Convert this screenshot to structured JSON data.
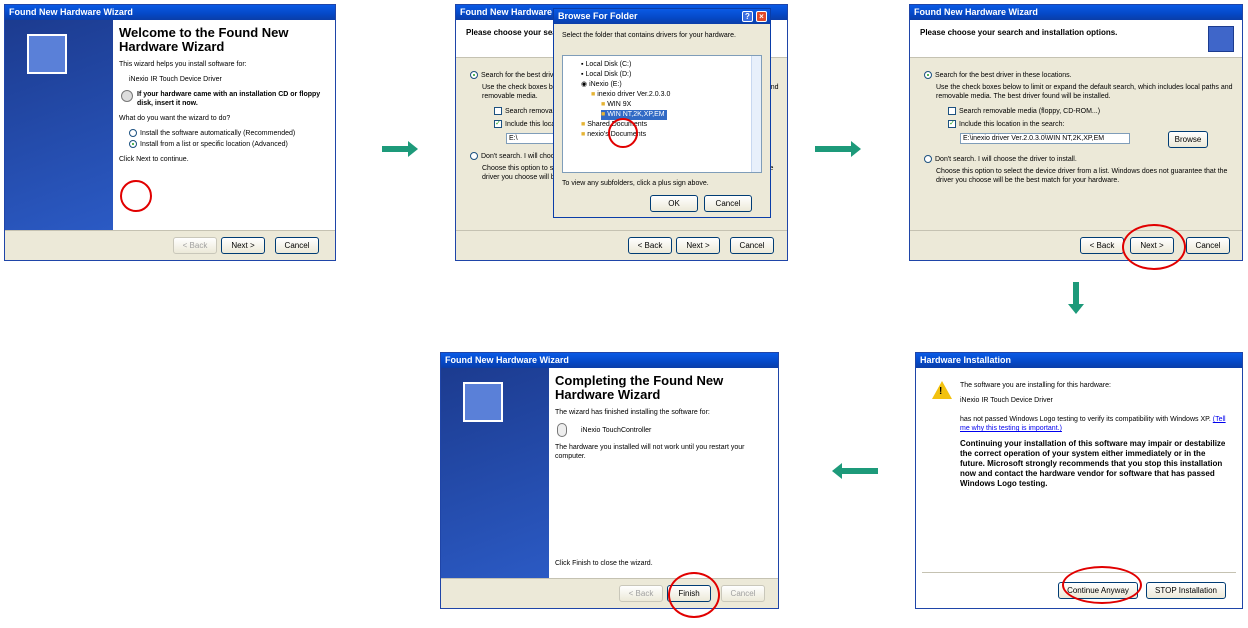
{
  "w1": {
    "title": "Found New Hardware Wizard",
    "heading": "Welcome to the Found New Hardware Wizard",
    "intro": "This wizard helps you install software for:",
    "device": "iNexio IR Touch Device Driver",
    "cd_text": "If your hardware came with an installation CD or floppy disk, insert it now.",
    "question": "What do you want the wizard to do?",
    "opt1": "Install the software automatically (Recommended)",
    "opt2": "Install from a list or specific location (Advanced)",
    "continue": "Click Next to continue.",
    "back": "< Back",
    "next": "Next >",
    "cancel": "Cancel"
  },
  "w2": {
    "title": "Found New Hardware Wizard",
    "header": "Please choose your search and installation options.",
    "search_best": "Search for the best driver in these locations.",
    "use_check": "Use the check boxes below to limit or expand the default search, which includes local paths and removable media.",
    "search_removable": "Search removable media",
    "include": "Include this location in the search:",
    "path": "E:\\",
    "dont_search": "Don't search. I will choose the driver to install.",
    "choose": "Choose this option to select the device driver from a list. Windows does not guarantee that the driver you choose will be the best match for your hardware.",
    "back": "< Back",
    "next": "Next >",
    "cancel": "Cancel",
    "dialog": {
      "title": "Browse For Folder",
      "prompt": "Select the folder that contains drivers for your hardware.",
      "tree": [
        "Local Disk (C:)",
        "Local Disk (D:)",
        "iNexio (E:)",
        "inexio driver Ver.2.0.3.0",
        "WIN 9X",
        "WIN NT,2K,XP,EM",
        "Shared Documents",
        "nexio's Documents"
      ],
      "hint": "To view any subfolders, click a plus sign above.",
      "ok": "OK",
      "cancel": "Cancel"
    }
  },
  "w3": {
    "title": "Found New Hardware Wizard",
    "header": "Please choose your search and installation options.",
    "search_best": "Search for the best driver in these locations.",
    "use_check": "Use the check boxes below to limit or expand the default search, which includes local paths and removable media. The best driver found will be installed.",
    "search_removable": "Search removable media (floppy, CD-ROM...)",
    "include": "Include this location in the search:",
    "path": "E:\\inexio driver Ver.2.0.3.0\\WIN NT,2K,XP,EM",
    "browse": "Browse",
    "dont_search": "Don't search. I will choose the driver to install.",
    "choose": "Choose this option to select the device driver from a list. Windows does not guarantee that the driver you choose will be the best match for your hardware.",
    "back": "< Back",
    "next": "Next >",
    "cancel": "Cancel"
  },
  "w4": {
    "title": "Found New Hardware Wizard",
    "heading": "Completing the Found New Hardware Wizard",
    "finished": "The wizard has finished installing the software for:",
    "device": "iNexio TouchController",
    "restart": "The hardware you installed will not work until you restart your computer.",
    "finish_text": "Click Finish to close the wizard.",
    "back": "< Back",
    "finish": "Finish",
    "cancel": "Cancel"
  },
  "w5": {
    "title": "Hardware Installation",
    "installing": "The software you are installing for this hardware:",
    "device": "iNexio IR Touch Device Driver",
    "not_passed": "has not passed Windows Logo testing to verify its compatibility with Windows XP.",
    "link": "(Tell me why this testing is important.)",
    "warning": "Continuing your installation of this software may impair or destabilize the correct operation of your system either immediately or in the future. Microsoft strongly recommends that you stop this installation now and contact the hardware vendor for software that has passed Windows Logo testing.",
    "continue": "Continue Anyway",
    "stop": "STOP Installation"
  },
  "colors": {
    "title_bar": "#0548c6",
    "highlight_circle": "#e10000",
    "arrow": "#1d9a7a"
  }
}
